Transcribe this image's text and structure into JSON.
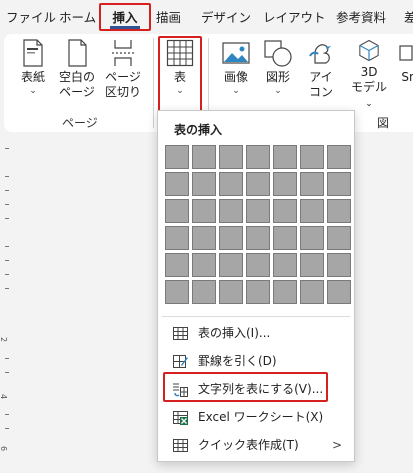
{
  "tabs": [
    "ファイル",
    "ホーム",
    "挿入",
    "描画",
    "デザイン",
    "レイアウト",
    "参考資料",
    "差"
  ],
  "active_tab": "挿入",
  "ribbon": {
    "buttons": [
      {
        "label": "表紙",
        "chevron": "⌄",
        "icon": "cover-page-icon"
      },
      {
        "label": "空白の\nページ",
        "icon": "blank-page-icon"
      },
      {
        "label": "ページ\n区切り",
        "icon": "page-break-icon"
      },
      {
        "label": "表",
        "chevron": "⌄",
        "icon": "table-icon"
      },
      {
        "label": "画像",
        "chevron": "⌄",
        "icon": "picture-icon"
      },
      {
        "label": "図形",
        "chevron": "⌄",
        "icon": "shapes-icon"
      },
      {
        "label": "アイ\nコン",
        "icon": "icons-icon"
      },
      {
        "label": "3D\nモデル",
        "chevron": "⌄",
        "icon": "3d-model-icon"
      },
      {
        "label": "Sm",
        "icon": "smartart-icon"
      }
    ],
    "groups": [
      "ページ",
      "図"
    ]
  },
  "dropdown": {
    "title": "表の挿入",
    "grid": {
      "rows": 6,
      "cols": 7
    },
    "items": [
      {
        "label": "表の挿入(I)...",
        "icon": "insert-table-icon"
      },
      {
        "label": "罫線を引く(D)",
        "icon": "draw-table-icon"
      },
      {
        "label": "文字列を表にする(V)...",
        "icon": "convert-text-to-table-icon"
      },
      {
        "label": "Excel ワークシート(X)",
        "icon": "excel-worksheet-icon"
      },
      {
        "label": "クイック表作成(T)",
        "icon": "quick-tables-icon",
        "arrow": ">"
      }
    ]
  },
  "ruler": {
    "numbers": [
      "2",
      "4",
      "6"
    ]
  },
  "highlight_color": "#d6201f"
}
